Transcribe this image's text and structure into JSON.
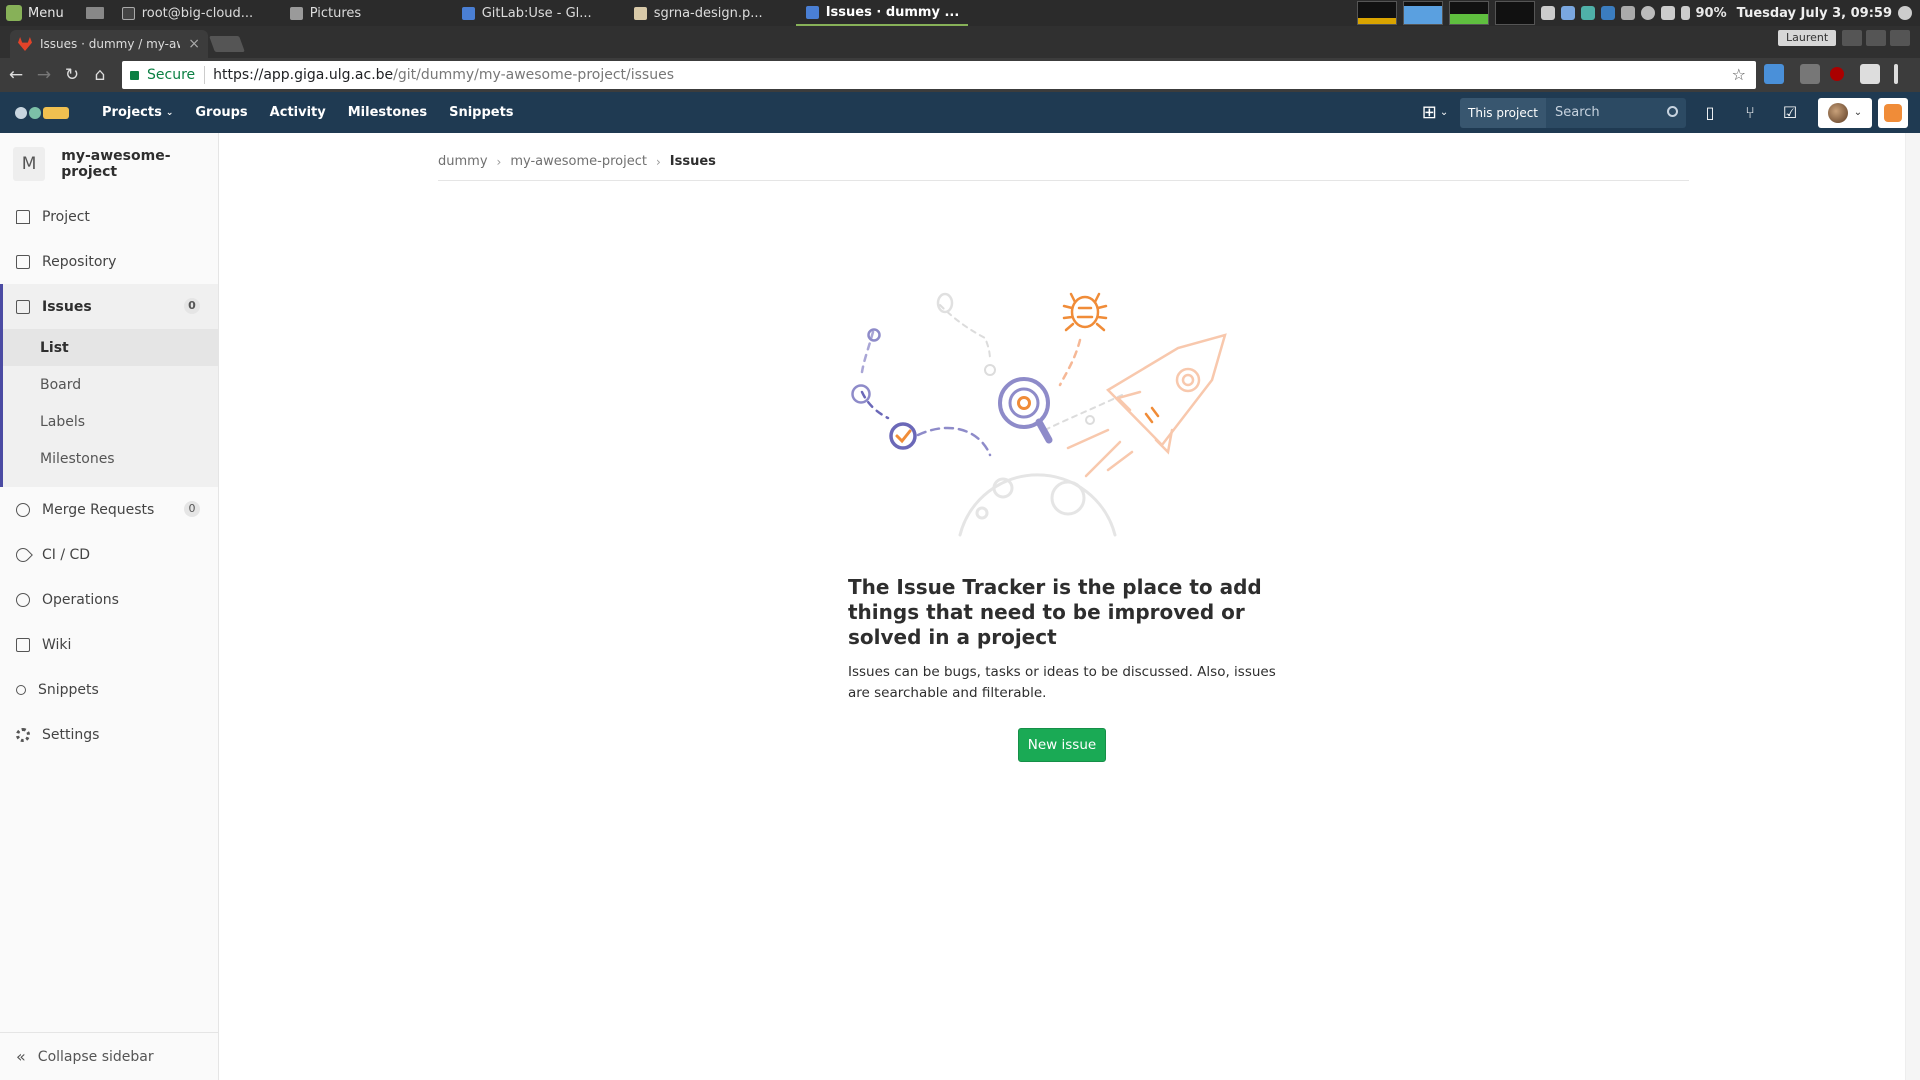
{
  "taskbar": {
    "menu_label": "Menu",
    "windows": [
      {
        "label": "root@big-cloud..."
      },
      {
        "label": "Pictures"
      },
      {
        "label": "GitLab:Use - Gl..."
      },
      {
        "label": "sgrna-design.p..."
      },
      {
        "label": "Issues · dummy ..."
      }
    ],
    "battery": "90%",
    "clock": "Tuesday July  3, 09:59"
  },
  "browser": {
    "tab_title": "Issues · dummy / my-aw",
    "profile_name": "Laurent",
    "secure_label": "Secure",
    "url_host": "https://app.giga.ulg.ac.be",
    "url_path": "/git/dummy/my-awesome-project/issues"
  },
  "gitlab_nav": {
    "links": [
      "Projects",
      "Groups",
      "Activity",
      "Milestones",
      "Snippets"
    ],
    "search_scope": "This project",
    "search_placeholder": "Search"
  },
  "sidebar": {
    "project_initial": "M",
    "project_name": "my-awesome-project",
    "items": [
      {
        "label": "Project",
        "icon": "home-icon"
      },
      {
        "label": "Repository",
        "icon": "doc-icon"
      },
      {
        "label": "Issues",
        "icon": "issues-icon",
        "count": "0",
        "active": true
      },
      {
        "label": "Merge Requests",
        "icon": "merge-request-icon",
        "count": "0"
      },
      {
        "label": "CI / CD",
        "icon": "rocket-icon"
      },
      {
        "label": "Operations",
        "icon": "cloud-gear-icon"
      },
      {
        "label": "Wiki",
        "icon": "book-icon"
      },
      {
        "label": "Snippets",
        "icon": "scissors-icon"
      },
      {
        "label": "Settings",
        "icon": "gear-icon"
      }
    ],
    "sub_items": [
      "List",
      "Board",
      "Labels",
      "Milestones"
    ],
    "collapse_label": "Collapse sidebar"
  },
  "breadcrumb": {
    "items": [
      "dummy",
      "my-awesome-project"
    ],
    "current": "Issues"
  },
  "empty_state": {
    "title": "The Issue Tracker is the place to add things that need to be improved or solved in a project",
    "description": "Issues can be bugs, tasks or ideas to be discussed. Also, issues are searchable and filterable.",
    "button_label": "New issue"
  },
  "colors": {
    "navbar": "#1f3a52",
    "accent": "#4b4ba3",
    "button": "#1aaa55",
    "orange": "#f08c38"
  }
}
